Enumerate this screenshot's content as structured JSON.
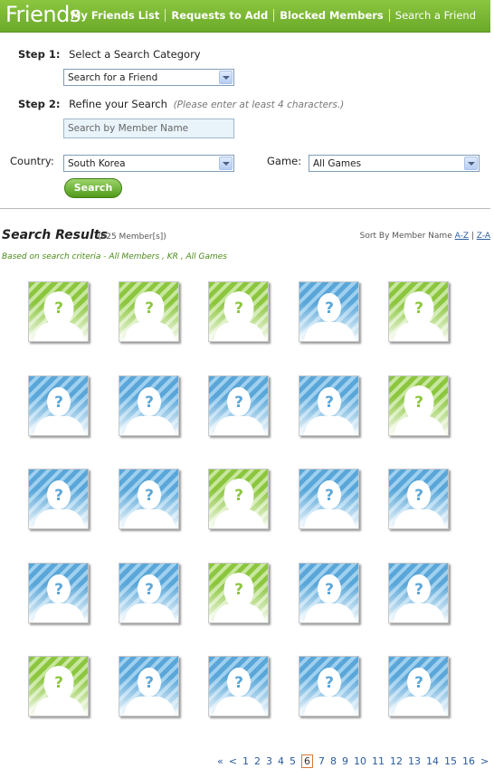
{
  "header": {
    "title": "Friends",
    "nav": [
      "My Friends List",
      "Requests to Add",
      "Blocked Members",
      "Search a Friend"
    ]
  },
  "form": {
    "step1_label": "Step 1:",
    "step1_text": "Select a Search Category",
    "category_value": "Search for a Friend",
    "step2_label": "Step 2:",
    "step2_text": "Refine your Search",
    "step2_hint": "(Please enter at least 4 characters.)",
    "member_placeholder": "Search by Member Name",
    "country_label": "Country:",
    "country_value": "South Korea",
    "game_label": "Game:",
    "game_value": "All Games",
    "search_button": "Search"
  },
  "results": {
    "title": "Search Results",
    "count": "(625 Member[s])",
    "sort_label": "Sort By Member Name",
    "sort_az": "A-Z",
    "sort_sep": "|",
    "sort_za": "Z-A",
    "criteria": "Based on search criteria - All Members , KR , All Games",
    "avatars": [
      [
        "green",
        "female"
      ],
      [
        "green",
        "female"
      ],
      [
        "green",
        "female"
      ],
      [
        "blue",
        "male"
      ],
      [
        "green",
        "female"
      ],
      [
        "blue",
        "male"
      ],
      [
        "blue",
        "male"
      ],
      [
        "blue",
        "male"
      ],
      [
        "blue",
        "male"
      ],
      [
        "green",
        "female"
      ],
      [
        "blue",
        "male"
      ],
      [
        "blue",
        "male"
      ],
      [
        "green",
        "female"
      ],
      [
        "blue",
        "male"
      ],
      [
        "blue",
        "male"
      ],
      [
        "blue",
        "male"
      ],
      [
        "blue",
        "male"
      ],
      [
        "green",
        "female"
      ],
      [
        "blue",
        "male"
      ],
      [
        "blue",
        "male"
      ],
      [
        "green",
        "female"
      ],
      [
        "blue",
        "male"
      ],
      [
        "blue",
        "male"
      ],
      [
        "blue",
        "male"
      ],
      [
        "blue",
        "male"
      ]
    ]
  },
  "pagination": {
    "first": "«",
    "prev": "<",
    "pages": [
      "1",
      "2",
      "3",
      "4",
      "5",
      "6",
      "7",
      "8",
      "9",
      "10",
      "11",
      "12",
      "13",
      "14",
      "15",
      "16"
    ],
    "current": "6",
    "next": ">",
    "last": "»"
  },
  "colors": {
    "brand_green": "#8cc63f",
    "avatar_blue": "#5aa6d8",
    "link_blue": "#2a5a9a"
  }
}
